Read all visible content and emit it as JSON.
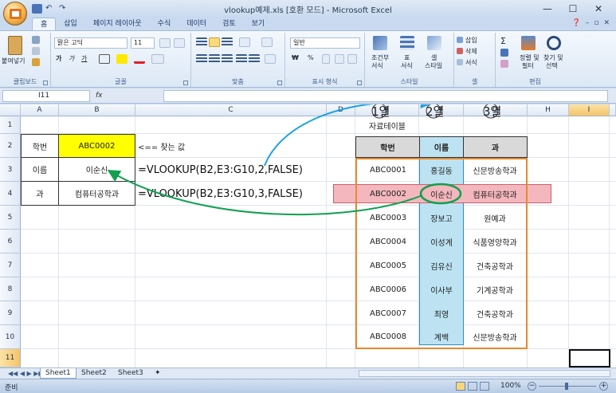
{
  "window": {
    "title": "vlookup예제.xls [호환 모드] - Microsoft Excel",
    "minimize": "—",
    "maximize": "☐",
    "close": "✕"
  },
  "ribbon": {
    "tabs": [
      "홈",
      "삽입",
      "페이지 레이아웃",
      "수식",
      "데이터",
      "검토",
      "보기"
    ],
    "active_tab": "홈",
    "clipboard": {
      "paste": "붙여넣기",
      "label": "클립보드"
    },
    "font": {
      "name": "맑은 고딕",
      "size": "11",
      "bold": "가",
      "italic": "가",
      "underline": "가",
      "label": "글꼴"
    },
    "alignment": {
      "label": "맞춤"
    },
    "number": {
      "format": "일반",
      "currency": "₩",
      "percent": "%",
      "label": "표시 형식"
    },
    "styles": {
      "conditional": "조건부",
      "conditional2": "서식",
      "table": "표",
      "table2": "서식",
      "cell": "셀",
      "cell2": "스타일",
      "label": "스타일"
    },
    "cells": {
      "insert": "삽입",
      "delete": "삭제",
      "format": "서식",
      "label": "셀"
    },
    "editing": {
      "sigma": "Σ",
      "sort": "정렬 및",
      "sort2": "필터",
      "find": "찾기 및",
      "find2": "선택",
      "label": "편집"
    }
  },
  "formula_bar": {
    "name_box": "I11",
    "fx": "fx",
    "value": ""
  },
  "columns": [
    "A",
    "B",
    "C",
    "D",
    "E",
    "F",
    "G",
    "H",
    "I"
  ],
  "rows": [
    "1",
    "2",
    "3",
    "4",
    "5",
    "6",
    "7",
    "8",
    "9",
    "10",
    "11"
  ],
  "cells": {
    "A2": "학번",
    "B2": "ABC0002",
    "C2": "<== 찾는 값",
    "A3": "이름",
    "B3": "이순신",
    "C3": "=VLOOKUP(B2,E3:G10,2,FALSE)",
    "A4": "과",
    "B4": "컴퓨터공학과",
    "C4": "=VLOOKUP(B2,E3:G10,3,FALSE)",
    "E1": "자료테이블"
  },
  "column_labels": [
    "1열",
    "2열",
    "3열"
  ],
  "table": {
    "headers": [
      "학번",
      "이름",
      "과"
    ],
    "rows": [
      [
        "ABC0001",
        "홍길동",
        "신문방송학과"
      ],
      [
        "ABC0002",
        "이순신",
        "컴퓨터공학과"
      ],
      [
        "ABC0003",
        "장보고",
        "원예과"
      ],
      [
        "ABC0004",
        "이성계",
        "식품영양학과"
      ],
      [
        "ABC0005",
        "김유신",
        "건축공학과"
      ],
      [
        "ABC0006",
        "이사부",
        "기계공학과"
      ],
      [
        "ABC0007",
        "최영",
        "건축공학과"
      ],
      [
        "ABC0008",
        "계백",
        "신문방송학과"
      ]
    ]
  },
  "sheets": [
    "Sheet1",
    "Sheet2",
    "Sheet3"
  ],
  "active_sheet": "Sheet1",
  "status": {
    "text": "준비",
    "zoom": "100%"
  },
  "colors": {
    "highlight_yellow": "#ffff00",
    "row_highlight": "#f4b7bd",
    "column_highlight": "#bde3f3",
    "table_border": "#e58a2e",
    "arrow_blue": "#1ea0e6",
    "arrow_green": "#10a050"
  }
}
